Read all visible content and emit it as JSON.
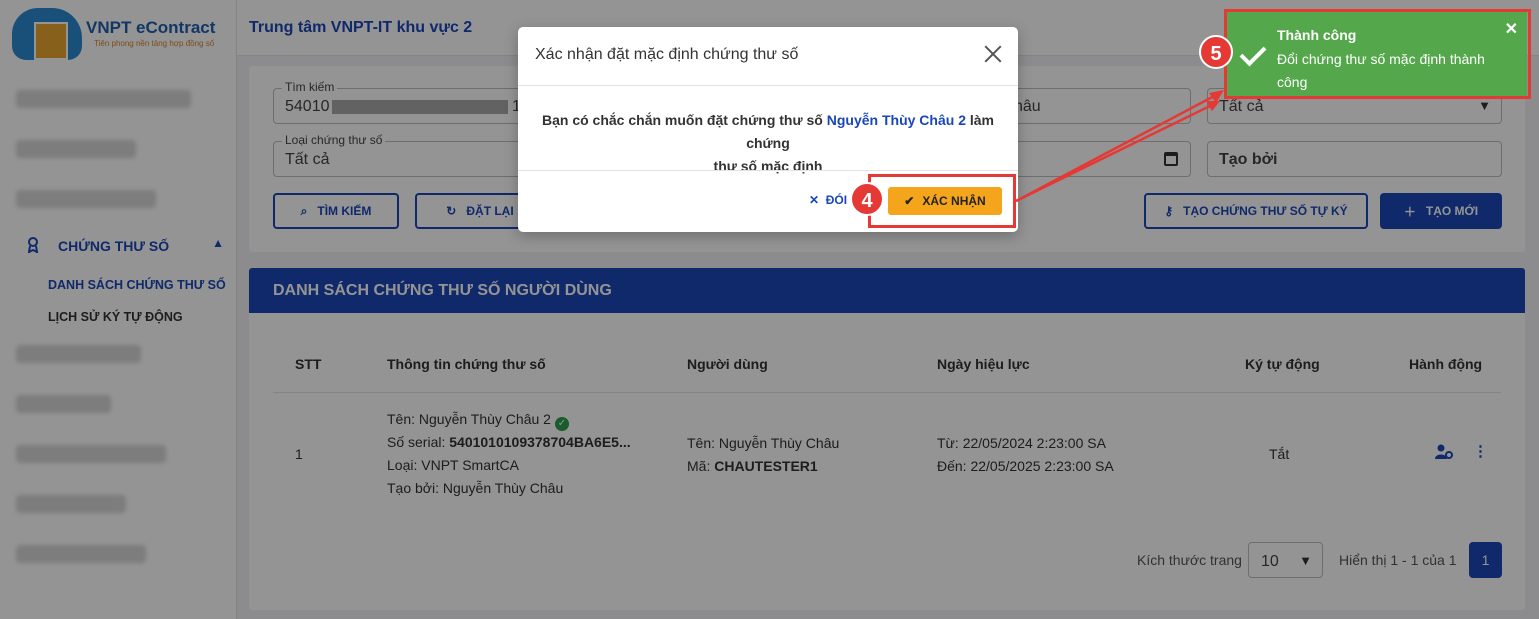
{
  "app": {
    "brand": "VNPT eContract",
    "slogan": "Tiên phong nền tảng hợp đồng số",
    "org": "Trung tâm VNPT-IT khu vực 2"
  },
  "sidebar": {
    "group_label": "CHỨNG THƯ SỐ",
    "items": [
      {
        "label": "DANH SÁCH CHỨNG THƯ SỐ",
        "active": true
      },
      {
        "label": "LỊCH SỬ KÝ TỰ ĐỘNG",
        "active": false
      }
    ]
  },
  "filters": {
    "search_label": "Tìm kiếm",
    "search_value_prefix": "54010",
    "search_value_suffix": "1",
    "name_value_tail": "hâu",
    "status_value": "Tất cả",
    "type_label": "Loại chứng thư số",
    "type_value": "Tất cả",
    "created_by_placeholder": "Tạo bởi"
  },
  "buttons": {
    "search": "TÌM KIẾM",
    "reset": "ĐẶT LẠI",
    "self_sign": "TẠO CHỨNG THƯ SỐ TỰ KÝ",
    "create": "TẠO MỚI"
  },
  "list": {
    "title": "DANH SÁCH CHỨNG THƯ SỐ NGƯỜI DÙNG",
    "headers": [
      "STT",
      "Thông tin chứng thư số",
      "Người dùng",
      "Ngày hiệu lực",
      "Ký tự động",
      "Hành động"
    ],
    "rows": [
      {
        "stt": "1",
        "cert_name": "Tên: Nguyễn Thùy Châu 2",
        "serial_label": "Số serial:",
        "serial_value": "5401010109378704BA6E5...",
        "type": "Loại: VNPT SmartCA",
        "created_by": "Tạo bởi: Nguyễn Thùy Châu",
        "user_name": "Tên: Nguyễn Thùy Châu",
        "user_code_label": "Mã:",
        "user_code": "CHAUTESTER1",
        "valid_from": "Từ: 22/05/2024 2:23:00 SA",
        "valid_to": "Đến: 22/05/2025 2:23:00 SA",
        "auto_sign": "Tắt"
      }
    ],
    "page_size_label": "Kích thước trang",
    "page_size": "10",
    "display_info": "Hiển thị 1 - 1 của 1",
    "current_page": "1"
  },
  "modal": {
    "title": "Xác nhận đặt mặc định chứng thư số",
    "body_prefix": "Bạn có chắc chắn muốn đặt chứng thư số",
    "body_highlight": "Nguyễn Thùy Châu 2",
    "body_suffix": "làm chứng",
    "body_line2": "thư số mặc định",
    "close_label": "ĐÓNG",
    "close_label_visible": "ĐÓI",
    "confirm_label": "XÁC NHẬN"
  },
  "toast": {
    "title": "Thành công",
    "message": "Đổi chứng thư số mặc định thành công"
  },
  "annotations": {
    "step_confirm": "4",
    "step_toast": "5",
    "color": "#e53935"
  },
  "colors": {
    "primary": "#1a47b8",
    "confirm": "#f4a51c",
    "success": "#54a84b"
  }
}
